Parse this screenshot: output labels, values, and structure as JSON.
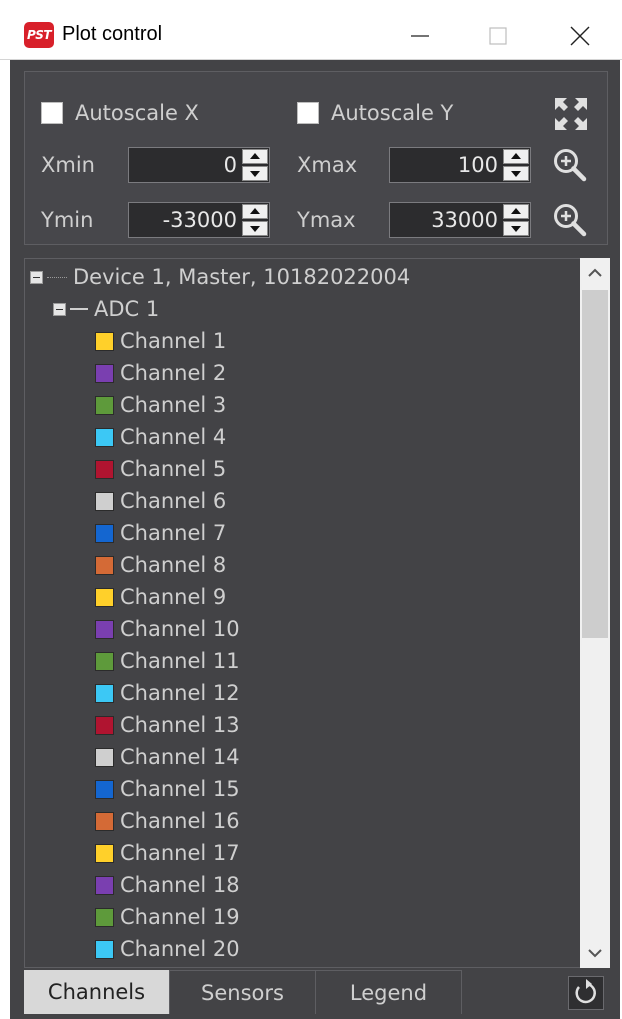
{
  "window": {
    "title": "Plot control",
    "app_icon_text": "PST"
  },
  "axes": {
    "autoscale_x_label": "Autoscale X",
    "autoscale_x_checked": false,
    "autoscale_y_label": "Autoscale Y",
    "autoscale_y_checked": false,
    "xmin_label": "Xmin",
    "xmin_value": "0",
    "xmax_label": "Xmax",
    "xmax_value": "100",
    "ymin_label": "Ymin",
    "ymin_value": "-33000",
    "ymax_label": "Ymax",
    "ymax_value": "33000"
  },
  "tree": {
    "device_label": "Device 1, Master, 10182022004",
    "adc_label": "ADC 1",
    "channels": [
      {
        "label": "Channel 1",
        "color": "#ffd02a"
      },
      {
        "label": "Channel 2",
        "color": "#7a3fb0"
      },
      {
        "label": "Channel 3",
        "color": "#5e9a3b"
      },
      {
        "label": "Channel 4",
        "color": "#3cc8f5"
      },
      {
        "label": "Channel 5",
        "color": "#b01430"
      },
      {
        "label": "Channel 6",
        "color": "#cfcfcf"
      },
      {
        "label": "Channel 7",
        "color": "#1466d0"
      },
      {
        "label": "Channel 8",
        "color": "#d46a36"
      },
      {
        "label": "Channel 9",
        "color": "#ffd02a"
      },
      {
        "label": "Channel 10",
        "color": "#7a3fb0"
      },
      {
        "label": "Channel 11",
        "color": "#5e9a3b"
      },
      {
        "label": "Channel 12",
        "color": "#3cc8f5"
      },
      {
        "label": "Channel 13",
        "color": "#b01430"
      },
      {
        "label": "Channel 14",
        "color": "#cfcfcf"
      },
      {
        "label": "Channel 15",
        "color": "#1466d0"
      },
      {
        "label": "Channel 16",
        "color": "#d46a36"
      },
      {
        "label": "Channel 17",
        "color": "#ffd02a"
      },
      {
        "label": "Channel 18",
        "color": "#7a3fb0"
      },
      {
        "label": "Channel 19",
        "color": "#5e9a3b"
      },
      {
        "label": "Channel 20",
        "color": "#3cc8f5"
      }
    ]
  },
  "tabs": [
    {
      "label": "Channels",
      "active": true
    },
    {
      "label": "Sensors",
      "active": false
    },
    {
      "label": "Legend",
      "active": false
    }
  ],
  "icons": {
    "close": "close-icon",
    "minimize": "minimize-icon",
    "maximize": "maximize-icon",
    "expand": "expand-icon",
    "zoom": "zoom-in-icon",
    "reset": "reset-icon"
  }
}
